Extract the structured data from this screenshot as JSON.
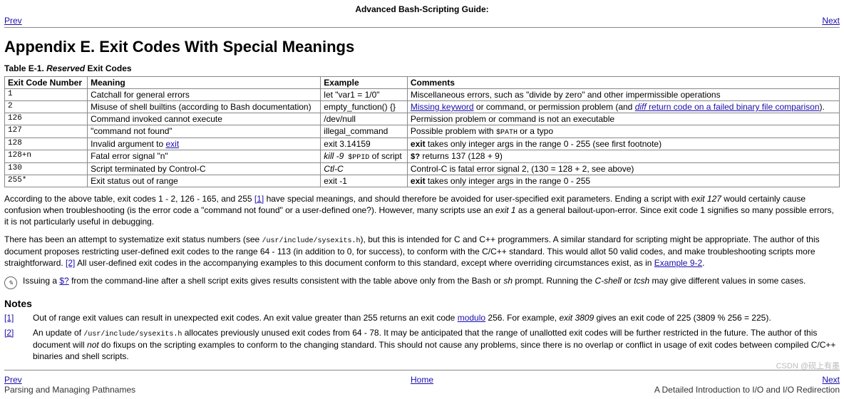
{
  "top_title": "Advanced Bash-Scripting Guide:",
  "nav": {
    "prev": "Prev",
    "next": "Next",
    "home": "Home"
  },
  "page_heading": "Appendix E. Exit Codes With Special Meanings",
  "table_caption_strong": "Table E-1. ",
  "table_caption_em": "Reserved",
  "table_caption_tail": " Exit Codes",
  "headers": {
    "c1": "Exit Code Number",
    "c2": "Meaning",
    "c3": "Example",
    "c4": "Comments"
  },
  "rows": {
    "r0": {
      "code": "1",
      "meaning": "Catchall for general errors",
      "example": "let \"var1 = 1/0\"",
      "comment": "Miscellaneous errors, such as \"divide by zero\" and other impermissible operations"
    },
    "r1": {
      "code": "2",
      "meaning": "Misuse of shell builtins (according to Bash documentation)",
      "example": "empty_function() {}",
      "cmt_a": "Missing keyword",
      "cmt_b": " or command, or permission problem (and ",
      "cmt_c": "diff",
      "cmt_d": " return code on a failed binary file comparison",
      "cmt_e": ")."
    },
    "r2": {
      "code": "126",
      "meaning": "Command invoked cannot execute",
      "example": "/dev/null",
      "comment": "Permission problem or command is not an executable"
    },
    "r3": {
      "code": "127",
      "meaning": "\"command not found\"",
      "example": "illegal_command",
      "cmt_a": "Possible problem with ",
      "cmt_b": "$PATH",
      "cmt_c": " or a typo"
    },
    "r4": {
      "code": "128",
      "meaning_a": "Invalid argument to ",
      "meaning_link": "exit",
      "example": "exit 3.14159",
      "cmt_a": "exit",
      "cmt_b": " takes only integer args in the range 0 - 255 (see first footnote)"
    },
    "r5": {
      "code": "128+n",
      "meaning": "Fatal error signal \"n\"",
      "ex_a": "kill -9",
      "ex_b": " $PPID",
      "ex_c": " of script",
      "cmt_a": "$?",
      "cmt_b": " returns 137 (128 + 9)"
    },
    "r6": {
      "code": "130",
      "meaning": "Script terminated by Control-C",
      "example": "Ctl-C",
      "comment": "Control-C is fatal error signal 2, (130 = 128 + 2, see above)"
    },
    "r7": {
      "code": "255*",
      "meaning": "Exit status out of range",
      "example": "exit -1",
      "cmt_a": "exit",
      "cmt_b": " takes only integer args in the range 0 - 255"
    }
  },
  "para1": {
    "a": "According to the above table, exit codes 1 - 2, 126 - 165, and 255 ",
    "link1": "[1]",
    "b": " have special meanings, and should therefore be avoided for user-specified exit parameters. Ending a script with ",
    "c": "exit 127",
    "d": " would certainly cause confusion when troubleshooting (is the error code a \"command not found\" or a user-defined one?). However, many scripts use an ",
    "e": "exit 1",
    "f": " as a general bailout-upon-error. Since exit code 1 signifies so many possible errors, it is not particularly useful in debugging."
  },
  "para2": {
    "a": "There has been an attempt to systematize exit status numbers (see ",
    "b": "/usr/include/sysexits.h",
    "c": "), but this is intended for C and C++ programmers. A similar standard for scripting might be appropriate. The author of this document proposes restricting user-defined exit codes to the range 64 - 113 (in addition to 0, for success), to conform with the C/C++ standard. This would allot 50 valid codes, and make troubleshooting scripts more straightforward. ",
    "link2": "[2]",
    "d": " All user-defined exit codes in the accompanying examples to this document conform to this standard, except where overriding circumstances exist, as in ",
    "exlink": "Example 9-2",
    "e": "."
  },
  "note": {
    "a": "Issuing a ",
    "link": "$?",
    "b": " from the command-line after a shell script exits gives results consistent with the table above only from the Bash or ",
    "c": "sh",
    "d": " prompt. Running the ",
    "e": "C-shell",
    "f": " or ",
    "g": "tcsh",
    "h": " may give different values in some cases."
  },
  "notes_heading": "Notes",
  "fn1": {
    "num": "[1]",
    "a": "Out of range exit values can result in unexpected exit codes. An exit value greater than 255 returns an exit code ",
    "link": "modulo",
    "b": " 256. For example, ",
    "c": "exit 3809",
    "d": " gives an exit code of 225 (3809 % 256 = 225)."
  },
  "fn2": {
    "num": "[2]",
    "a": "An update of ",
    "b": "/usr/include/sysexits.h",
    "c": " allocates previously unused exit codes from 64 - 78. It may be anticipated that the range of unallotted exit codes will be further restricted in the future. The author of this document will ",
    "d": "not",
    "e": " do fixups on the scripting examples to conform to the changing standard. This should not cause any problems, since there is no overlap or conflict in usage of exit codes between compiled C/C++ binaries and shell scripts."
  },
  "bottom_left": "Parsing and Managing Pathnames",
  "bottom_right": "A Detailed Introduction to I/O and I/O Redirection",
  "watermark": "CSDN @砚上有墨"
}
